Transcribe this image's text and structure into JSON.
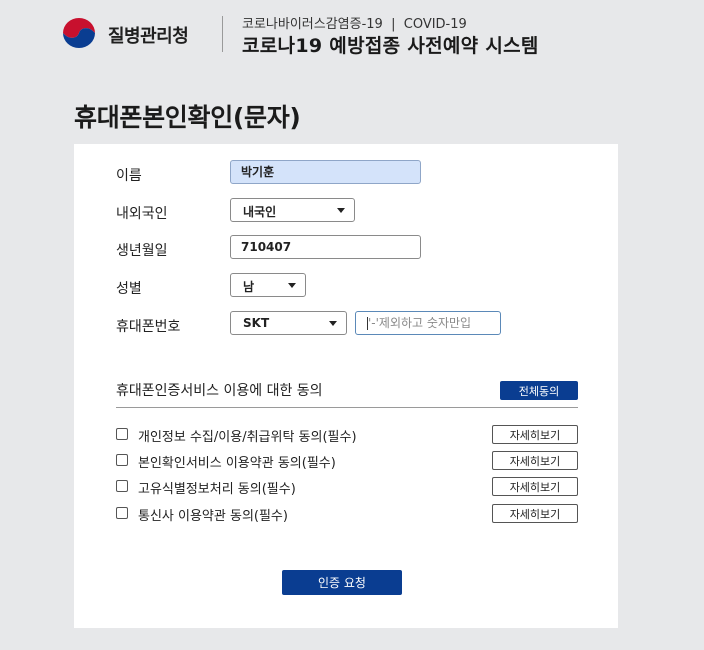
{
  "header": {
    "agency_name": "질병관리청",
    "subtitle": "코로나바이러스감염증-19  |  COVID-19",
    "title": "코로나19 예방접종 사전예약 시스템",
    "colors": {
      "red": "#c8102e",
      "blue": "#0a3d91"
    }
  },
  "page": {
    "title": "휴대폰본인확인(문자)"
  },
  "form": {
    "name_label": "이름",
    "name_value": "박기훈",
    "nationality_label": "내외국인",
    "nationality_value": "내국인",
    "birth_label": "생년월일",
    "birth_value": "710407",
    "gender_label": "성별",
    "gender_value": "남",
    "phone_label": "휴대폰번호",
    "carrier_value": "SKT",
    "phone_placeholder": "'-'제외하고 숫자만입"
  },
  "consent": {
    "heading": "휴대폰인증서비스 이용에 대한 동의",
    "agree_all_label": "전체동의",
    "items": [
      {
        "label": "개인정보 수집/이용/취급위탁 동의(필수)",
        "detail_label": "자세히보기"
      },
      {
        "label": "본인확인서비스 이용약관 동의(필수)",
        "detail_label": "자세히보기"
      },
      {
        "label": "고유식별정보처리 동의(필수)",
        "detail_label": "자세히보기"
      },
      {
        "label": "통신사 이용약관 동의(필수)",
        "detail_label": "자세히보기"
      }
    ]
  },
  "actions": {
    "request_label": "인증 요청"
  }
}
